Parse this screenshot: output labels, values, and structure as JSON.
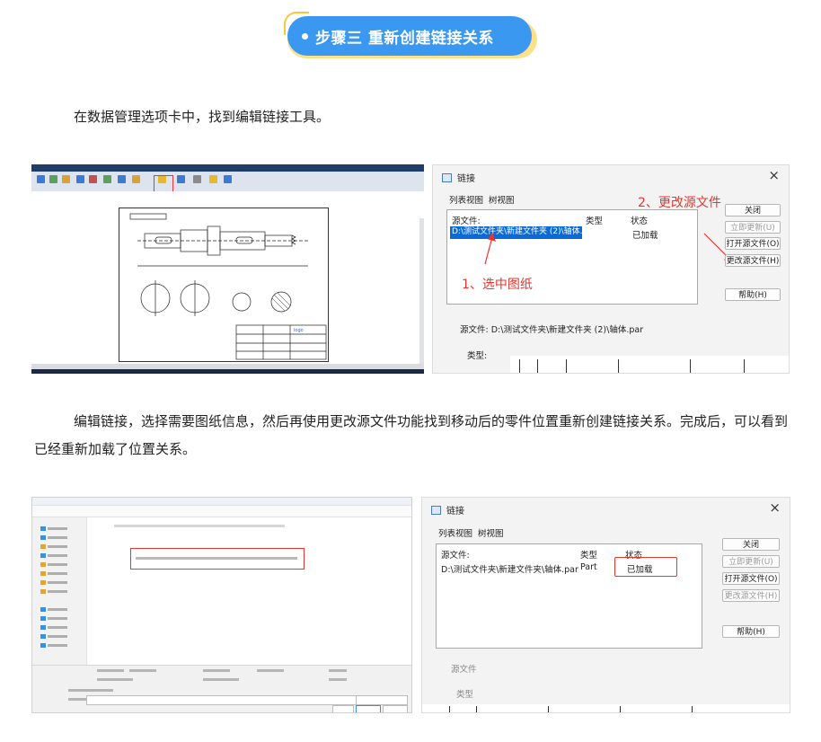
{
  "banner": {
    "title": "步骤三 重新创建链接关系"
  },
  "paragraphs": {
    "p1": "在数据管理选项卡中，找到编辑链接工具。",
    "p2": "编辑链接，选择需要图纸信息，然后再使用更改源文件功能找到移动后的零件位置重新创建链接关系。完成后，可以看到已经重新加载了位置关系。"
  },
  "dialog1": {
    "title": "链接",
    "tabs": [
      "列表视图",
      "树视图"
    ],
    "columns": [
      "源文件:",
      "类型",
      "状态"
    ],
    "row": {
      "source": "D:\\测试文件夹\\新建文件夹 (2)\\轴体....",
      "status": "已加载"
    },
    "buttons": {
      "close": "关闭",
      "update_now": "立即更新(U)",
      "open_source": "打开源文件(O)",
      "change_source": "更改源文件(H)",
      "help": "帮助(H)"
    },
    "source_label": "源文件:",
    "source_value": "D:\\测试文件夹\\新建文件夹 (2)\\轴体.par",
    "type_label": "类型:",
    "annotation_1": "1、选中图纸",
    "annotation_2": "2、更改源文件"
  },
  "dialog2": {
    "title": "链接",
    "tabs": [
      "列表视图",
      "树视图"
    ],
    "columns": [
      "源文件:",
      "类型",
      "状态"
    ],
    "row": {
      "source": "D:\\测试文件夹\\新建文件夹\\轴体.par",
      "type": "Part",
      "status": "已加载"
    },
    "buttons": {
      "close": "关闭",
      "update_now": "立即更新(U)",
      "open_source": "打开源文件(O)",
      "change_source": "更改源文件(H)",
      "help": "帮助(H)"
    },
    "source_label": "源文件",
    "type_label": "类型"
  },
  "colors": {
    "banner_blue": "#3b98f0",
    "banner_yellow": "#ffe08a",
    "annotation_red": "#e8352f",
    "selection_blue": "#0a6ad8"
  }
}
